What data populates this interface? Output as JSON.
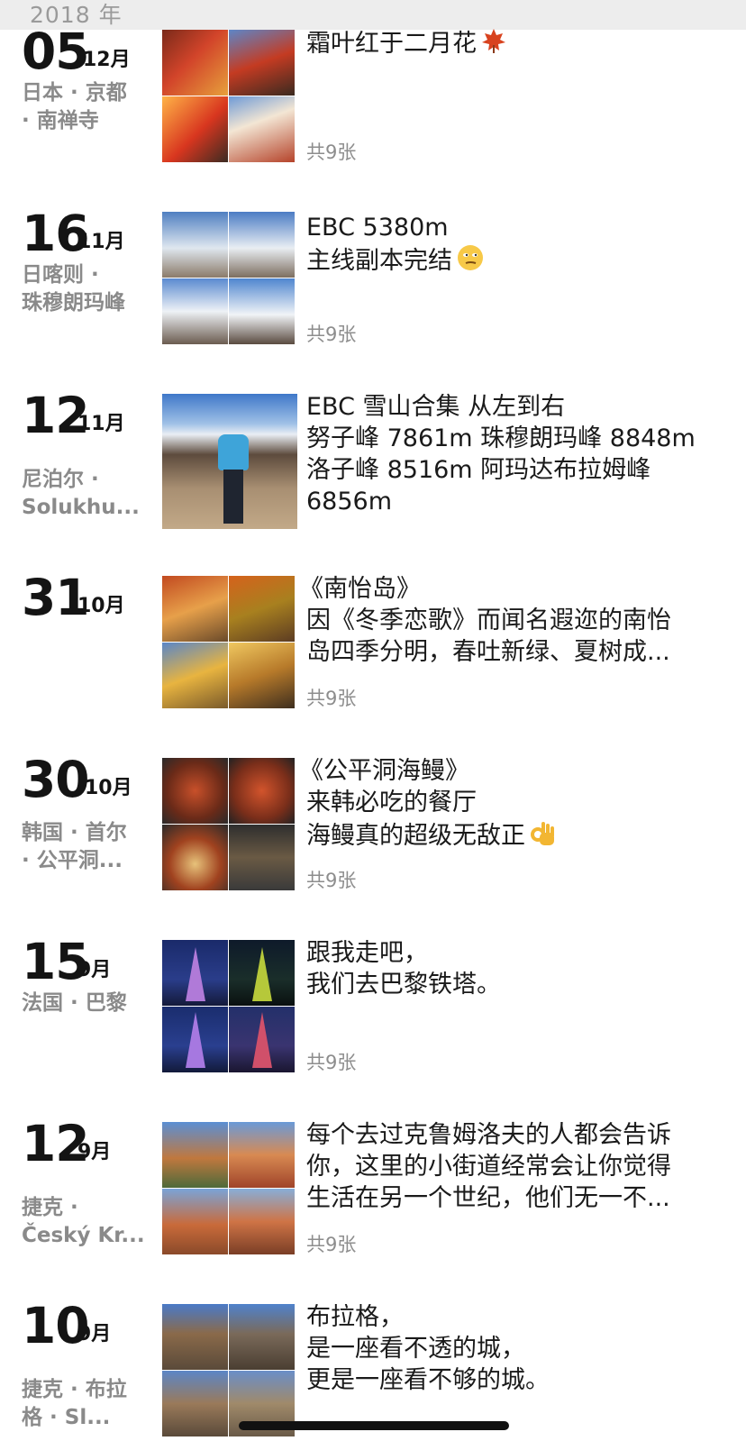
{
  "year_header": "2018 年",
  "entries": [
    {
      "day": "05",
      "month": "12月",
      "location": "日本 · 京都\n· 南禅寺",
      "caption_lines": [
        "霜叶红于二月花"
      ],
      "caption_emoji": "maple-leaf-icon",
      "count": "共9张",
      "photos": [
        "#c0392b",
        "#d35400",
        "#e67e22",
        "#8e5a3c"
      ]
    },
    {
      "day": "16",
      "month": "11月",
      "location": "日喀则 ·\n珠穆朗玛峰",
      "caption_lines": [
        "EBC 5380m",
        "主线副本完结"
      ],
      "caption_emoji": "smirk-face-icon",
      "count": "共9张",
      "photos": [
        "#7fa7d6",
        "#9cbbe0",
        "#8aaad1",
        "#a9c1dd"
      ]
    },
    {
      "day": "12",
      "month": "11月",
      "location": "尼泊尔 ·\nSolukhu...",
      "caption_lines": [
        "EBC 雪山合集 从左到右",
        "努子峰 7861m 珠穆朗玛峰 8848m",
        "洛子峰 8516m 阿玛达布拉姆峰",
        "6856m"
      ],
      "count": "",
      "photos": [
        "#6f94c4"
      ]
    },
    {
      "day": "31",
      "month": "10月",
      "location": "",
      "caption_lines": [
        "《南怡岛》",
        "因《冬季恋歌》而闻名遐迩的南怡",
        "岛四季分明，春吐新绿、夏树成..."
      ],
      "count": "共9张",
      "photos": [
        "#b9541e",
        "#c8741f",
        "#d9a13a",
        "#a65b2a"
      ]
    },
    {
      "day": "30",
      "month": "10月",
      "location": "韩国 · 首尔\n· 公平洞...",
      "caption_lines": [
        "《公平洞海鳗》",
        "来韩必吃的餐厅",
        "海鳗真的超级无敌正"
      ],
      "caption_emoji": "ok-hand-icon",
      "count": "共9张",
      "photos": [
        "#8a3b22",
        "#9b4526",
        "#6b2c1a",
        "#3e3a36"
      ]
    },
    {
      "day": "15",
      "month": "9月",
      "location": "法国 · 巴黎",
      "caption_lines": [
        "跟我走吧，",
        "我们去巴黎铁塔。"
      ],
      "count": "共9张",
      "photos": [
        "#2a2a7a",
        "#1f3a2e",
        "#262a6e",
        "#2b2350"
      ]
    },
    {
      "day": "12",
      "month": "9月",
      "location": "捷克 ·\nČeský Kr...",
      "caption_lines": [
        "每个去过克鲁姆洛夫的人都会告诉",
        "你，这里的小街道经常会让你觉得",
        "生活在另一个世纪，他们无一不..."
      ],
      "count": "共9张",
      "photos": [
        "#a35d3d",
        "#b86b44",
        "#94563c",
        "#a86a4a"
      ]
    },
    {
      "day": "10",
      "month": "9月",
      "location": "捷克 · 布拉\n格 · Sl...",
      "caption_lines": [
        "布拉格，",
        "是一座看不透的城，",
        "更是一座看不够的城。"
      ],
      "count": "",
      "photos": [
        "#8a6a4a",
        "#7a8aa6",
        "#6e7f9e",
        "#8c7157"
      ]
    }
  ]
}
